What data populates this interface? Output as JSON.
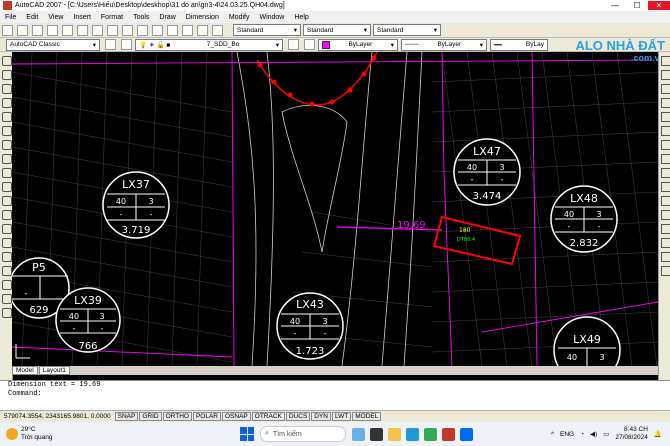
{
  "window": {
    "title": "AutoCAD 2007 - [C:\\Users\\Hiếu\\Desktop\\deskhop\\31 do an\\gn3-4\\24.03.25.QH04.dwg]",
    "minimize": "—",
    "maximize": "☐",
    "close": "✕"
  },
  "menu": [
    "File",
    "Edit",
    "View",
    "Insert",
    "Format",
    "Tools",
    "Draw",
    "Dimension",
    "Modify",
    "Window",
    "Help"
  ],
  "toolbar": {
    "text_style": "Standard",
    "dim_style": "Standard",
    "table_style": "Standard",
    "workspace": "AutoCAD Classic",
    "layer": "7_SDD_Bo",
    "color": "ByLayer",
    "linetype": "ByLayer",
    "lineweight": "ByLay"
  },
  "watermark": {
    "line1": "ALO NHÀ ĐẤT",
    "line2": ".com.vn"
  },
  "plots": [
    {
      "id": "LX37",
      "c1": "40",
      "c2": "3",
      "d1": "-",
      "d2": "-",
      "area": "3.719"
    },
    {
      "id": "LX47",
      "c1": "40",
      "c2": "3",
      "d1": "-",
      "d2": "-",
      "area": "3.474"
    },
    {
      "id": "LX48",
      "c1": "40",
      "c2": "3",
      "d1": "-",
      "d2": "-",
      "area": "2.832"
    },
    {
      "id": "P5",
      "c1": "",
      "c2": "",
      "d1": "-",
      "d2": "",
      "area": "629"
    },
    {
      "id": "LX39",
      "c1": "40",
      "c2": "3",
      "d1": "-",
      "d2": "-",
      "area": "766"
    },
    {
      "id": "LX43",
      "c1": "40",
      "c2": "3",
      "d1": "-",
      "d2": "-",
      "area": "1.723"
    },
    {
      "id": "LX49",
      "c1": "40",
      "c2": "3",
      "d1": "",
      "d2": "",
      "area": ""
    }
  ],
  "dimension_value": "19.69",
  "highlight_labels": {
    "a": "180",
    "b": "DT86.4"
  },
  "tabs": [
    "Model",
    "Layout1"
  ],
  "command": {
    "line1": "Dimension text = 19.69",
    "line2": "Command:"
  },
  "status": {
    "coords": "579074.3554, 2343165.9801, 0.0000",
    "toggles": [
      "SNAP",
      "GRID",
      "ORTHO",
      "POLAR",
      "OSNAP",
      "OTRACK",
      "DUCS",
      "DYN",
      "LWT",
      "MODEL"
    ]
  },
  "taskbar": {
    "temp": "29°C",
    "weather": "Trời quang",
    "search": "Tìm kiếm",
    "lang": "ENG",
    "time": "8:43 CH",
    "date": "27/08/2024"
  },
  "colors": {
    "accent": "#ff00ff",
    "redline": "#ff0000",
    "watermark": "#2aa0e0"
  }
}
